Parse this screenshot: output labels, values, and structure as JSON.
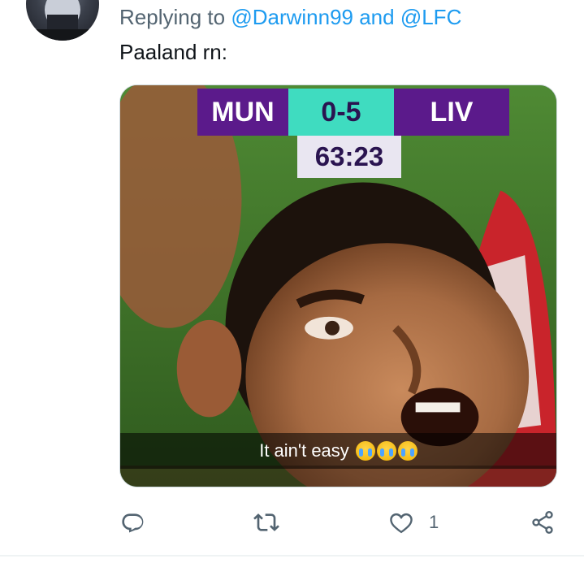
{
  "tweet": {
    "reply_prefix": "Replying to ",
    "mention_1": "@Darwinn99",
    "mention_join": " and ",
    "mention_2": "@LFC",
    "text": "Paaland rn:"
  },
  "media": {
    "scoreboard": {
      "home": "MUN",
      "score": "0-5",
      "away": "LIV",
      "clock": "63:23"
    },
    "caption": "It ain't easy",
    "caption_emoji": [
      "loudly-crying-face",
      "loudly-crying-face",
      "loudly-crying-face"
    ]
  },
  "actions": {
    "reply_icon": "reply-icon",
    "retweet_icon": "retweet-icon",
    "like_icon": "heart-icon",
    "like_count": "1",
    "share_icon": "share-icon"
  },
  "colors": {
    "mention": "#1d9bf0",
    "secondary_text": "#536471",
    "primary_text": "#0f1419",
    "scoreboard_team_bg": "#5b1a8b",
    "scoreboard_score_bg": "#3fdcc0"
  }
}
